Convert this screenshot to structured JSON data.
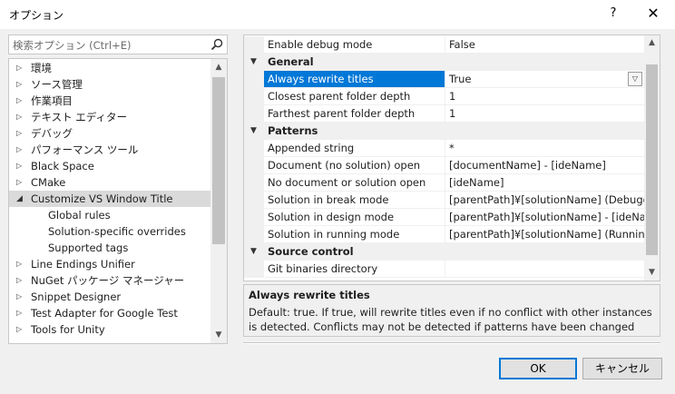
{
  "window": {
    "title": "オプション",
    "help": "?",
    "close": "✕"
  },
  "search": {
    "placeholder": "検索オプション (Ctrl+E)"
  },
  "tree": {
    "items": [
      {
        "label": "環境",
        "level": 0,
        "expanded": false
      },
      {
        "label": "ソース管理",
        "level": 0,
        "expanded": false
      },
      {
        "label": "作業項目",
        "level": 0,
        "expanded": false
      },
      {
        "label": "テキスト エディター",
        "level": 0,
        "expanded": false
      },
      {
        "label": "デバッグ",
        "level": 0,
        "expanded": false
      },
      {
        "label": "パフォーマンス ツール",
        "level": 0,
        "expanded": false
      },
      {
        "label": "Black Space",
        "level": 0,
        "expanded": false
      },
      {
        "label": "CMake",
        "level": 0,
        "expanded": false
      },
      {
        "label": "Customize VS Window Title",
        "level": 0,
        "expanded": true,
        "selected": true
      },
      {
        "label": "Global rules",
        "level": 1
      },
      {
        "label": "Solution-specific overrides",
        "level": 1
      },
      {
        "label": "Supported tags",
        "level": 1
      },
      {
        "label": "Line Endings Unifier",
        "level": 0,
        "expanded": false
      },
      {
        "label": "NuGet パッケージ マネージャー",
        "level": 0,
        "expanded": false
      },
      {
        "label": "Snippet Designer",
        "level": 0,
        "expanded": false
      },
      {
        "label": "Test Adapter for Google Test",
        "level": 0,
        "expanded": false
      },
      {
        "label": "Tools for Unity",
        "level": 0,
        "expanded": false
      }
    ]
  },
  "grid": {
    "rows": [
      {
        "type": "prop",
        "name": "Enable debug mode",
        "value": "False"
      },
      {
        "type": "cat",
        "name": "General"
      },
      {
        "type": "prop",
        "name": "Always rewrite titles",
        "value": "True",
        "selected": true
      },
      {
        "type": "prop",
        "name": "Closest parent folder depth",
        "value": "1"
      },
      {
        "type": "prop",
        "name": "Farthest parent folder depth",
        "value": "1"
      },
      {
        "type": "cat",
        "name": "Patterns"
      },
      {
        "type": "prop",
        "name": "Appended string",
        "value": "*"
      },
      {
        "type": "prop",
        "name": "Document (no solution) open",
        "value": "[documentName] - [ideName]"
      },
      {
        "type": "prop",
        "name": "No document or solution open",
        "value": "[ideName]"
      },
      {
        "type": "prop",
        "name": "Solution in break mode",
        "value": "[parentPath]¥[solutionName] (Debugging)"
      },
      {
        "type": "prop",
        "name": "Solution in design mode",
        "value": "[parentPath]¥[solutionName] - [ideName]"
      },
      {
        "type": "prop",
        "name": "Solution in running mode",
        "value": "[parentPath]¥[solutionName] (Running) - [ideName]"
      },
      {
        "type": "cat",
        "name": "Source control"
      },
      {
        "type": "prop",
        "name": "Git binaries directory",
        "value": ""
      }
    ]
  },
  "description": {
    "title": "Always rewrite titles",
    "text": "Default: true. If true, will rewrite titles even if no conflict with other instances is detected. Conflicts may not be detected if patterns have been changed from the def..."
  },
  "buttons": {
    "ok": "OK",
    "cancel": "キャンセル"
  },
  "colors": {
    "accent": "#0078d7",
    "selection": "#dadada",
    "background": "#f0f0f0"
  }
}
